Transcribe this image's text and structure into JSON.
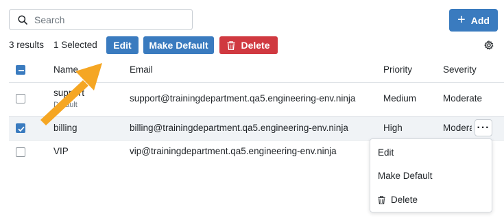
{
  "search": {
    "placeholder": "Search"
  },
  "add_button": {
    "icon": "plus-icon",
    "label": "Add"
  },
  "toolbar": {
    "results": "3 results",
    "selected": "1 Selected",
    "edit_label": "Edit",
    "make_default_label": "Make Default",
    "delete_label": "Delete"
  },
  "table": {
    "columns": [
      "Name",
      "Email",
      "Priority",
      "Severity"
    ],
    "rows": [
      {
        "name": "support",
        "sub": "Default",
        "email": "support@trainingdepartment.qa5.engineering-env.ninja",
        "priority": "Medium",
        "severity": "Moderate",
        "checked": false
      },
      {
        "name": "billing",
        "sub": "",
        "email": "billing@trainingdepartment.qa5.engineering-env.ninja",
        "priority": "High",
        "severity": "Moderate",
        "checked": true
      },
      {
        "name": "VIP",
        "sub": "",
        "email": "vip@trainingdepartment.qa5.engineering-env.ninja",
        "priority": "",
        "severity": "",
        "checked": false
      }
    ]
  },
  "context_menu": {
    "items": [
      "Edit",
      "Make Default",
      "Delete"
    ]
  },
  "colors": {
    "primary": "#3a7bbf",
    "danger": "#d03940",
    "annotation_arrow": "#f5a623"
  }
}
